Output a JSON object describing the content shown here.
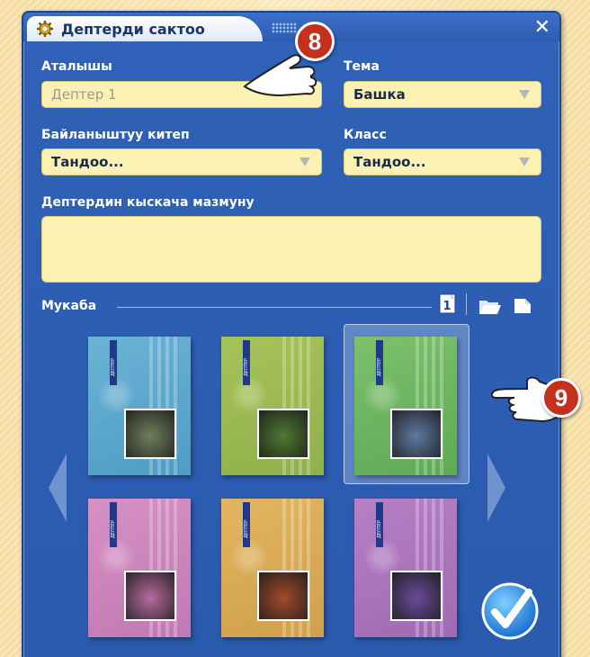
{
  "dialog": {
    "title": "Дептерди сактоо",
    "close_label": "✕"
  },
  "form": {
    "name_label": "Аталышы",
    "name_placeholder": "Дептер 1",
    "topic_label": "Тема",
    "topic_value": "Башка",
    "book_label": "Байланыштуу китеп",
    "book_value": "Тандоо...",
    "class_label": "Класс",
    "class_value": "Тандоо...",
    "summary_label": "Дептердин кыскача мазмуну",
    "summary_value": ""
  },
  "covers": {
    "section_label": "Мукаба",
    "tool_page_number": "1",
    "items": [
      {
        "color": "#6ab3d6",
        "stripe": "#4f9cc4",
        "photo": "#6f7f5c",
        "subject": "kingfisher"
      },
      {
        "color": "#a7c25a",
        "stripe": "#8fb04a",
        "photo": "#4d7a30",
        "subject": "frog"
      },
      {
        "color": "#7dc06c",
        "stripe": "#5eaa55",
        "photo": "#5e7aa0",
        "subject": "fox"
      },
      {
        "color": "#d590c4",
        "stripe": "#c07ab2",
        "photo": "#b86aa0",
        "subject": "flower"
      },
      {
        "color": "#e1b561",
        "stripe": "#d0a04c",
        "photo": "#a34a2c",
        "subject": "butterfly"
      },
      {
        "color": "#b77fc4",
        "stripe": "#a06ab2",
        "photo": "#6a4a9a",
        "subject": "ladybug"
      }
    ],
    "selected_index": 2,
    "ribbon_text": "ДЕПТЕР"
  },
  "callouts": {
    "step_a": "8",
    "step_b": "9"
  },
  "colors": {
    "dialog_bg": "#2f62b8",
    "field_bg": "#fbf1b3",
    "badge": "#c4301c"
  }
}
